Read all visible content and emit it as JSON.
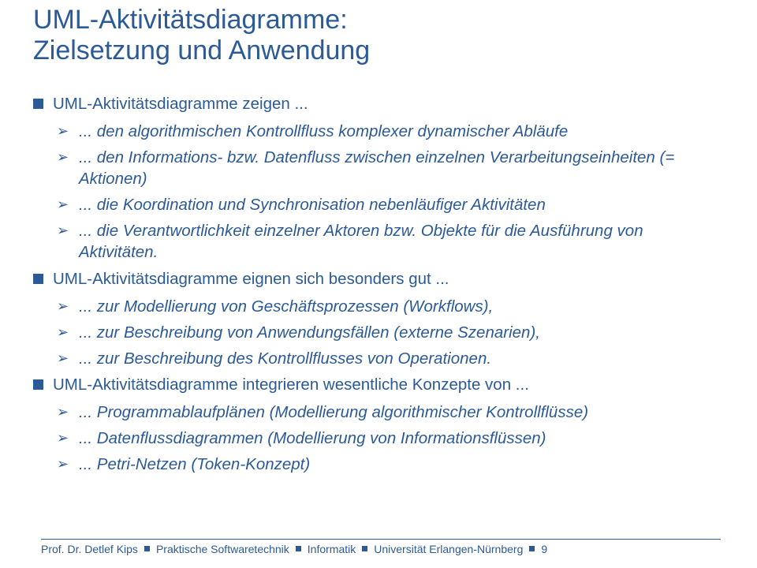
{
  "title": {
    "line1": "UML-Aktivitätsdiagramme:",
    "line2": "Zielsetzung und Anwendung"
  },
  "sections": {
    "s1": {
      "head": "UML-Aktivitätsdiagramme zeigen ...",
      "items": {
        "a": "... den algorithmischen Kontrollfluss komplexer dynamischer Abläufe",
        "b": "... den Informations- bzw. Datenfluss zwischen einzelnen Verarbeitungseinheiten (= Aktionen)",
        "c": "... die Koordination und Synchronisation nebenläufiger Aktivitäten",
        "d": "... die Verantwortlichkeit einzelner Aktoren bzw. Objekte für die Ausführung von Aktivitäten."
      }
    },
    "s2": {
      "head": "UML-Aktivitätsdiagramme eignen sich besonders gut ...",
      "items": {
        "a": "... zur Modellierung von Geschäftsprozessen (Workflows),",
        "b": "... zur Beschreibung von Anwendungsfällen (externe Szenarien),",
        "c": "... zur Beschreibung des Kontrollflusses von Operationen."
      }
    },
    "s3": {
      "head": "UML-Aktivitätsdiagramme integrieren wesentliche Konzepte von ...",
      "items": {
        "a": "... Programmablaufplänen (Modellierung algorithmischer Kontrollflüsse)",
        "b": "... Datenflussdiagrammen (Modellierung von Informationsflüssen)",
        "c": "... Petri-Netzen (Token-Konzept)"
      }
    }
  },
  "footer": {
    "author": "Prof. Dr. Detlef Kips",
    "course": "Praktische Softwaretechnik",
    "dept": "Informatik",
    "uni": "Universität Erlangen-Nürnberg",
    "page": "9"
  }
}
